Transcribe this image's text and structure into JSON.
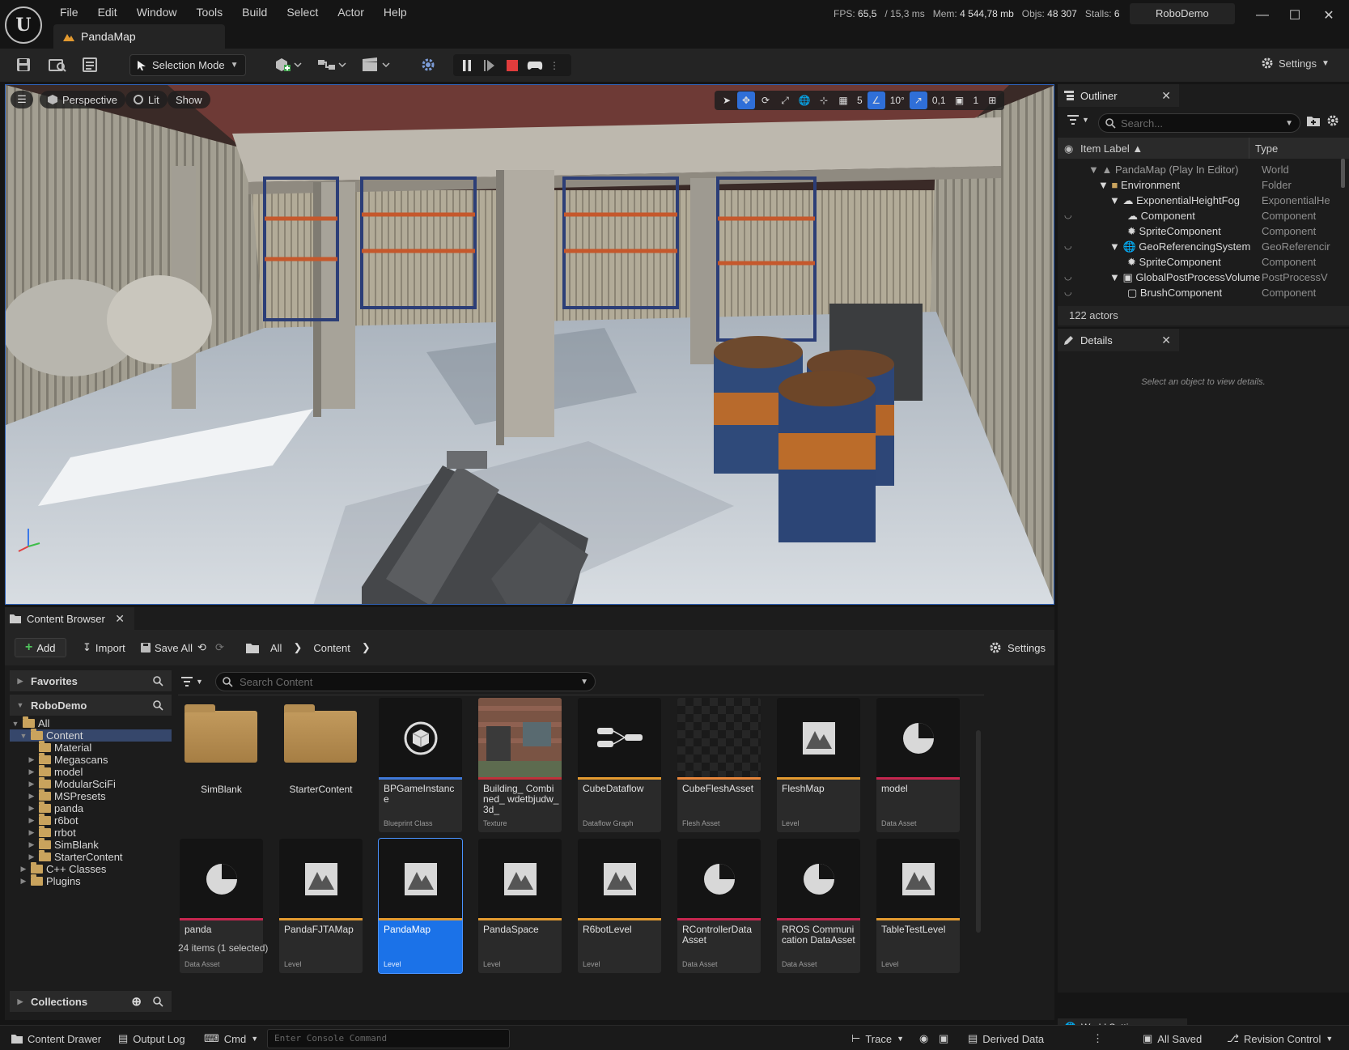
{
  "menu": [
    "File",
    "Edit",
    "Window",
    "Tools",
    "Build",
    "Select",
    "Actor",
    "Help"
  ],
  "stats": {
    "fps_label": "FPS:",
    "fps": "65,5",
    "ms": "/ 15,3 ms",
    "mem_label": "Mem:",
    "mem": "4 544,78 mb",
    "objs_label": "Objs:",
    "objs": "48 307",
    "stalls_label": "Stalls:",
    "stalls": "6"
  },
  "project_name": "RoboDemo",
  "document_tab": "PandaMap",
  "toolbar": {
    "selection_mode": "Selection Mode",
    "settings": "Settings"
  },
  "viewport": {
    "perspective": "Perspective",
    "lit": "Lit",
    "show": "Show",
    "grid_snap": "5",
    "rotation_snap": "10°",
    "scale_snap": "0,1",
    "camera_speed": "1"
  },
  "outliner": {
    "tab": "Outliner",
    "search_placeholder": "Search...",
    "col_label": "Item Label",
    "col_type": "Type",
    "rows": [
      {
        "label": "PandaMap (Play In Editor)",
        "type": "World"
      },
      {
        "label": "Environment",
        "type": "Folder"
      },
      {
        "label": "ExponentialHeightFog",
        "type": "ExponentialHe"
      },
      {
        "label": "Component",
        "type": "Component"
      },
      {
        "label": "SpriteComponent",
        "type": "Component"
      },
      {
        "label": "GeoReferencingSystem",
        "type": "GeoReferencir"
      },
      {
        "label": "SpriteComponent",
        "type": "Component"
      },
      {
        "label": "GlobalPostProcessVolume",
        "type": "PostProcessV"
      },
      {
        "label": "BrushComponent",
        "type": "Component"
      }
    ],
    "footer": "122 actors"
  },
  "details": {
    "tab": "Details",
    "empty_text": "Select an object to view details."
  },
  "content_browser": {
    "tab": "Content Browser",
    "add": "Add",
    "import": "Import",
    "save_all": "Save All",
    "crumbs": [
      "All",
      "Content"
    ],
    "settings": "Settings",
    "favorites": "Favorites",
    "project": "RoboDemo",
    "collections": "Collections",
    "search_placeholder": "Search Content",
    "tree": [
      "All",
      "Content",
      "Material",
      "Megascans",
      "model",
      "ModularSciFi",
      "MSPresets",
      "panda",
      "r6bot",
      "rrbot",
      "SimBlank",
      "StarterContent",
      "C++ Classes",
      "Plugins"
    ],
    "folders": [
      "SimBlank",
      "StarterContent"
    ],
    "assets": [
      {
        "name": "BPGameInstance",
        "kind": "Blueprint Class",
        "color": "#3f78d8"
      },
      {
        "name": "Building_ Combined_ wdetbjudw_3d_",
        "kind": "Texture",
        "color": "#c0313b"
      },
      {
        "name": "CubeDataflow",
        "kind": "Dataflow Graph",
        "color": "#e39a30"
      },
      {
        "name": "CubeFleshAsset",
        "kind": "Flesh Asset",
        "color": "#e8863a"
      },
      {
        "name": "FleshMap",
        "kind": "Level",
        "color": "#e39a30"
      },
      {
        "name": "model",
        "kind": "Data Asset",
        "color": "#c6264f"
      },
      {
        "name": "panda",
        "kind": "Data Asset",
        "color": "#c6264f"
      },
      {
        "name": "PandaFJTAMap",
        "kind": "Level",
        "color": "#e39a30"
      },
      {
        "name": "PandaMap",
        "kind": "Level",
        "color": "#e39a30"
      },
      {
        "name": "PandaSpace",
        "kind": "Level",
        "color": "#e39a30"
      },
      {
        "name": "R6botLevel",
        "kind": "Level",
        "color": "#e39a30"
      },
      {
        "name": "RControllerData Asset",
        "kind": "Data Asset",
        "color": "#c6264f"
      },
      {
        "name": "RROS Communication DataAsset",
        "kind": "Data Asset",
        "color": "#c6264f"
      },
      {
        "name": "TableTestLevel",
        "kind": "Level",
        "color": "#e39a30"
      }
    ],
    "items_count": "24 items (1 selected)"
  },
  "statusbar": {
    "content_drawer": "Content Drawer",
    "output_log": "Output Log",
    "cmd": "Cmd",
    "console_placeholder": "Enter Console Command",
    "trace": "Trace",
    "derived_data": "Derived Data",
    "all_saved": "All Saved",
    "revision_control": "Revision Control",
    "world_settings": "World Settings"
  }
}
